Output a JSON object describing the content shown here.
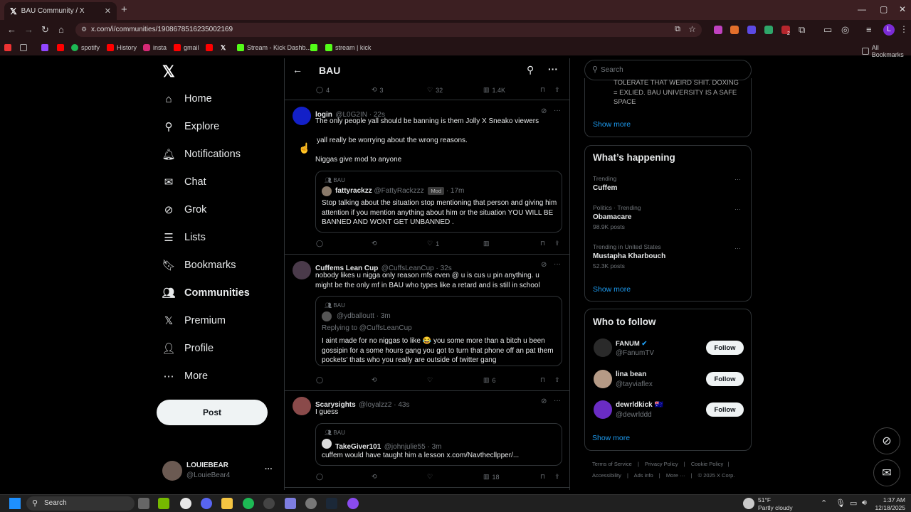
{
  "browser": {
    "tab_title": "BAU Community / X",
    "url": "x.com/i/communities/1908678516235002169",
    "bookmarks": [
      "spotify",
      "History",
      "insta",
      "gmail",
      "Stream - Kick Dashb...",
      "stream | kick"
    ],
    "all_bookmarks": "All Bookmarks",
    "ext_badge": "2"
  },
  "nav": {
    "items": [
      "Home",
      "Explore",
      "Notifications",
      "Chat",
      "Grok",
      "Lists",
      "Bookmarks",
      "Communities",
      "Premium",
      "Profile",
      "More"
    ],
    "post_label": "Post",
    "user_name": "LOUIEBEAR",
    "user_handle": "@LouieBear4",
    "more_dots": "···"
  },
  "feed": {
    "title": "BAU",
    "top_actions": {
      "replies": "4",
      "reposts": "3",
      "likes": "32",
      "views": "1.4K"
    },
    "posts": [
      {
        "name": "login",
        "handle": "@L0G2IN · 22s",
        "lines": [
          "The only people yall should be banning is them Jolly X Sneako viewers",
          "yall really be worrying about the wrong reasons.",
          "Niggas give mod to anyone"
        ],
        "quote": {
          "community": "BAU",
          "name": "fattyrackzz",
          "handle": "@FattyRackzzz",
          "badge": "Mod",
          "time": "· 17m",
          "text": "Stop talking about the situation stop mentioning that person and giving him attention if you mention anything about him or the situation YOU WILL BE BANNED AND WONT GET UNBANNED ."
        },
        "likes": "1"
      },
      {
        "name": "Cuffems Lean Cup",
        "handle": "@CuffsLeanCup · 32s",
        "lines": [
          "nobody likes u nigga only reason mfs even @ u is cus u pin anything. u might be the only mf in BAU who types like a retard and is still in school"
        ],
        "quote": {
          "community": "BAU",
          "handle": "@ydballoutt · 3m",
          "replying": "Replying to @CuffsLeanCup",
          "text": "I aint made for no niggas to like 😂 you some more than a bitch u been gossipin for a some hours gang you got to turn that phone off an pat them pockets' thats who you really are outside of twitter gang"
        },
        "views": "6"
      },
      {
        "name": "Scarysights",
        "handle": "@loyalzz2 · 43s",
        "lines": [
          "I guess"
        ],
        "quote": {
          "community": "BAU",
          "name": "TakeGiver101",
          "handle": "@johnjulie55 · 3m",
          "text": "cuffem would have taught him a lesson x.com/Navthecllpper/..."
        },
        "views": "18"
      }
    ]
  },
  "right": {
    "search_placeholder": "Search",
    "rules_text": [
      "TOLERATE THAT WEIRD SHIT. DOXING",
      "= EXLIED. BAU UNIVERSITY IS A SAFE",
      "SPACE"
    ],
    "show_more": "Show more",
    "happening_title": "What’s happening",
    "trends": [
      {
        "category": "Trending",
        "name": "Cuffem",
        "posts": ""
      },
      {
        "category": "Politics · Trending",
        "name": "Obamacare",
        "posts": "98.9K posts"
      },
      {
        "category": "Trending in United States",
        "name": "Mustapha Kharbouch",
        "posts": "52.3K posts"
      }
    ],
    "who_title": "Who to follow",
    "follow": [
      {
        "name": "FANUM",
        "handle": "@FanumTV"
      },
      {
        "name": "lina bean",
        "handle": "@tayviaflex"
      },
      {
        "name": "dewrldkick",
        "handle": "@dewrlddd"
      }
    ],
    "follow_label": "Follow",
    "footer": [
      "Terms of Service",
      "Privacy Policy",
      "Cookie Policy",
      "Accessibility",
      "Ads info",
      "More ···",
      "© 2025 X Corp."
    ]
  },
  "taskbar": {
    "search": "Search",
    "weather_temp": "51°F",
    "weather_desc": "Partly cloudy",
    "time": "1:37 AM",
    "date": "12/18/2025"
  },
  "colors": {
    "accent": "#1d9bf0",
    "tab_bg": "#3c1f22"
  }
}
